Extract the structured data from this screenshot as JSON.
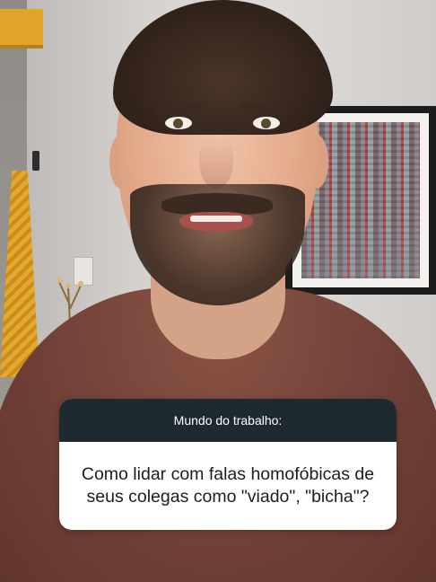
{
  "question_box": {
    "header": "Mundo do trabalho:",
    "question_line1": "Como lidar com falas homofóbicas de",
    "question_line2": "seus colegas como \"viado\", \"bicha\"?"
  },
  "colors": {
    "card_header_bg": "#1f2a30",
    "card_body_bg": "#ffffff",
    "shirt": "#75433a"
  }
}
